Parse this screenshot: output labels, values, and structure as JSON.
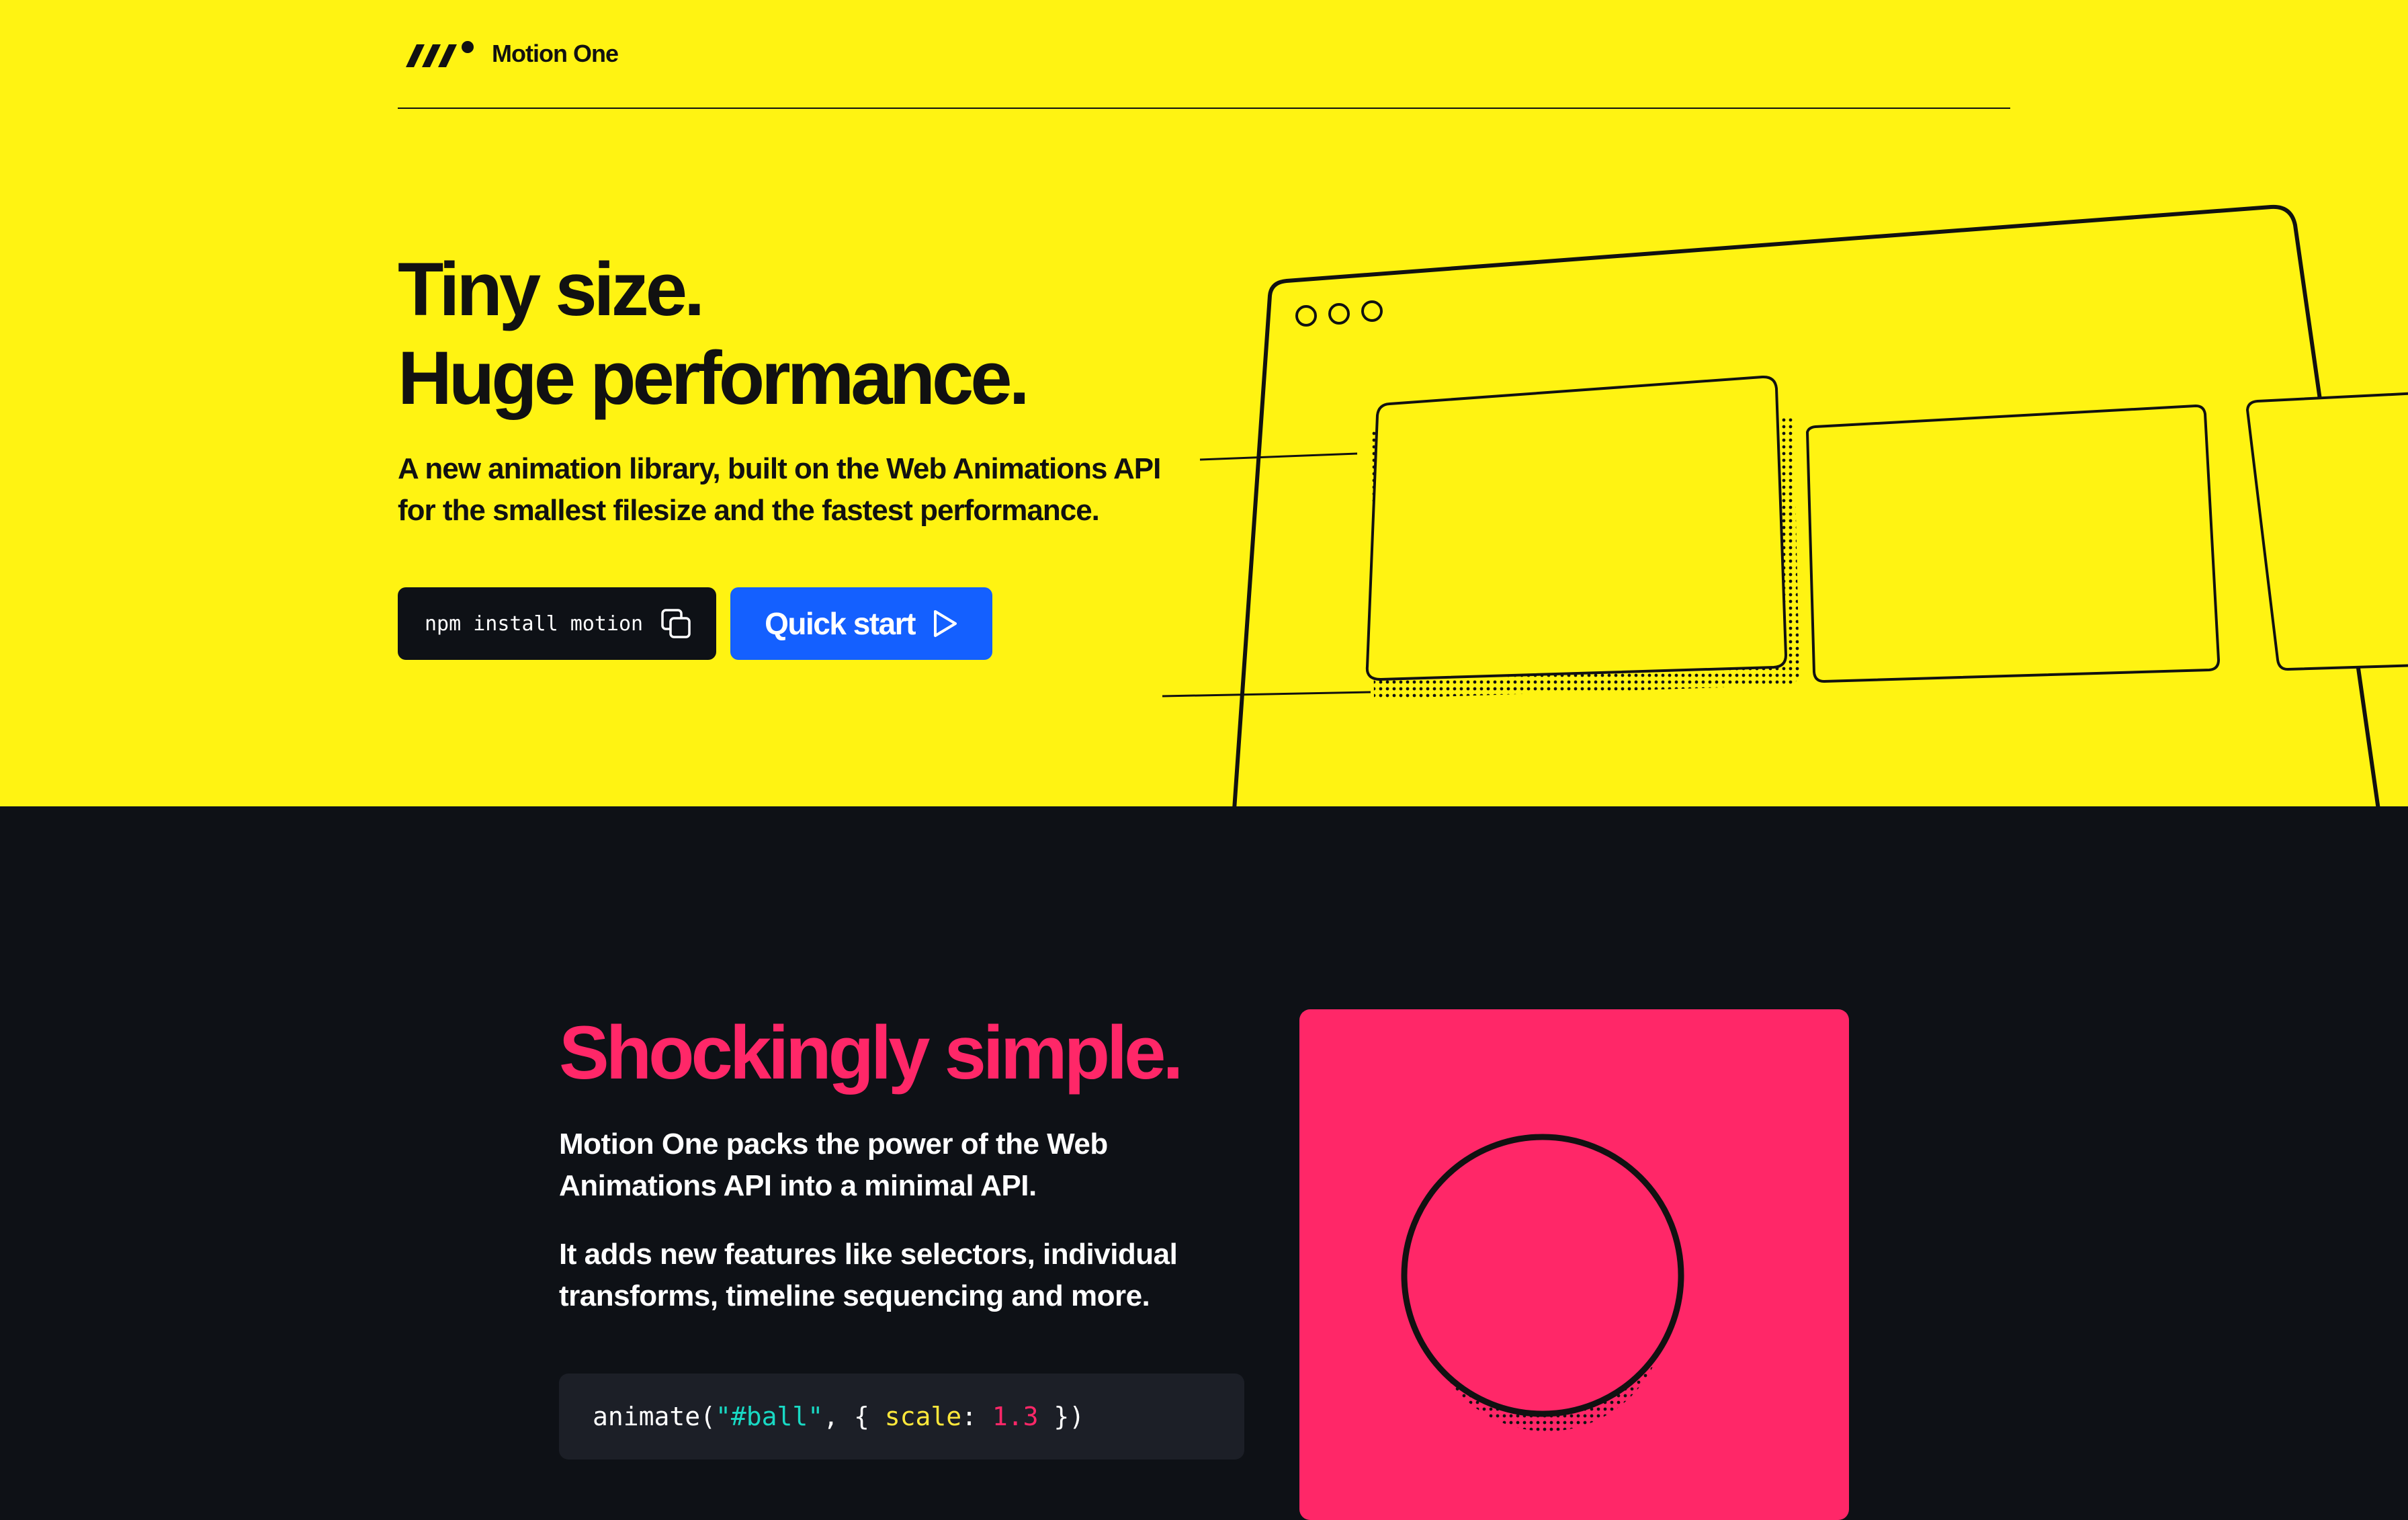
{
  "header": {
    "brand_name": "Motion One",
    "logo_icon": "motion-one-logo-icon"
  },
  "hero": {
    "title_line1": "Tiny size.",
    "title_line2": "Huge performance.",
    "subtitle_line1": "A new animation library, built on the Web Animations API",
    "subtitle_line2": "for the smallest filesize and the fastest performance.",
    "npm_command": "npm install motion",
    "copy_icon": "copy-icon",
    "quick_start_label": "Quick start",
    "play_icon": "play-icon",
    "background_color": "#fff312"
  },
  "feature": {
    "title": "Shockingly simple.",
    "paragraph1": "Motion One packs the power of the Web Animations API into a minimal API.",
    "paragraph2": "It adds new features like selectors, individual transforms, timeline sequencing and more.",
    "code": {
      "fn": "animate(",
      "selector": "\"#ball\"",
      "sep": ", { ",
      "key": "scale",
      "colon": ": ",
      "value": "1.3",
      "close": " })"
    },
    "accent_color": "#ff2768",
    "background_color": "#0e1116"
  },
  "colors": {
    "primary_button": "#1460ff",
    "dark": "#0e1116"
  }
}
